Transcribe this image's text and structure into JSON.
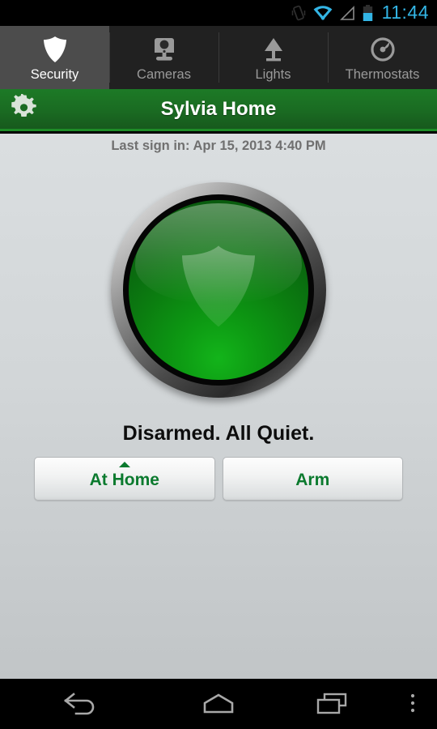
{
  "status_bar": {
    "time": "11:44",
    "icons": [
      {
        "name": "vibrate-icon",
        "label": "vibrate"
      },
      {
        "name": "wifi-icon",
        "label": "wifi"
      },
      {
        "name": "signal-icon",
        "label": "cellular-signal"
      },
      {
        "name": "battery-icon",
        "label": "battery"
      }
    ]
  },
  "tabs": [
    {
      "label": "Security",
      "icon": "shield-icon",
      "active": true
    },
    {
      "label": "Cameras",
      "icon": "camera-icon",
      "active": false
    },
    {
      "label": "Lights",
      "icon": "lamp-icon",
      "active": false
    },
    {
      "label": "Thermostats",
      "icon": "thermostat-icon",
      "active": false
    }
  ],
  "action_bar": {
    "title": "Sylvia Home",
    "settings_icon": "gear-icon"
  },
  "main": {
    "last_signin": "Last sign in: Apr 15, 2013 4:40 PM",
    "status_button": {
      "icon": "shield-icon",
      "state": "disarmed"
    },
    "status_text": "Disarmed. All Quiet.",
    "mode_buttons": [
      {
        "label": "At Home",
        "has_caret": true
      },
      {
        "label": "Arm",
        "has_caret": false
      }
    ]
  },
  "nav_bar": {
    "back": "back-icon",
    "home": "home-icon",
    "recents": "recents-icon",
    "overflow": "overflow-menu-icon"
  },
  "colors": {
    "accent_green": "#1b7a24",
    "status_green": "#0b7a2e",
    "status_blue": "#33b5e5",
    "background": "#d2d6d8",
    "tab_bar": "#212121",
    "tab_active": "#4c4c4c"
  }
}
